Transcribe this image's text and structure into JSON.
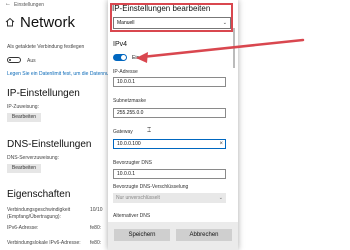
{
  "window": {
    "title": "Einstellungen",
    "minimize": "—",
    "maximize": "☐",
    "close": "✕",
    "back": "←"
  },
  "page": {
    "title": "Network"
  },
  "settings": {
    "metered_label": "Als getaktete Verbindung festlegen",
    "toggle_state": "Aus",
    "link": "Legen Sie ein Datenlimit fest, um die Datennutzu...",
    "ip_heading": "IP-Einstellungen",
    "ip_assignment_label": "IP-Zuweisung:",
    "edit_button": "Bearbeiten",
    "dns_heading": "DNS-Einstellungen",
    "dns_assignment_label": "DNS-Serverzuweisung:",
    "edit_button2": "Bearbeiten",
    "props_heading": "Eigenschaften",
    "prop1": "Verbindungsgeschwindigkeit",
    "prop1b": "(Empfang/Übertragung):",
    "prop2": "IPv6-Adresse:",
    "prop3": "Verbindungslokale IPv6-Adresse:",
    "val1": "10/10",
    "val2": "fe80:",
    "val3": "fe80:"
  },
  "dialog": {
    "title": "IP-Einstellungen bearbeiten",
    "mode_value": "Manuell",
    "section": "IPv4",
    "toggle_state": "Ein",
    "fields": [
      {
        "label": "IP-Adresse",
        "value": "10.0.0.1"
      },
      {
        "label": "Subnetzmaske",
        "value": "255.255.0.0"
      },
      {
        "label": "Gateway",
        "value": "10.0.0.100"
      },
      {
        "label": "Bevorzugter DNS",
        "value": "10.0.0.1"
      }
    ],
    "dns_encryption_label": "Bevorzugte DNS-Verschlüsselung",
    "dns_encryption_value": "Nur unverschlüsselt",
    "alt_dns_label": "Alternativer DNS",
    "save": "Speichern",
    "cancel": "Abbrechen"
  },
  "colors": {
    "accent": "#0067c0",
    "highlight": "#d9474f"
  }
}
